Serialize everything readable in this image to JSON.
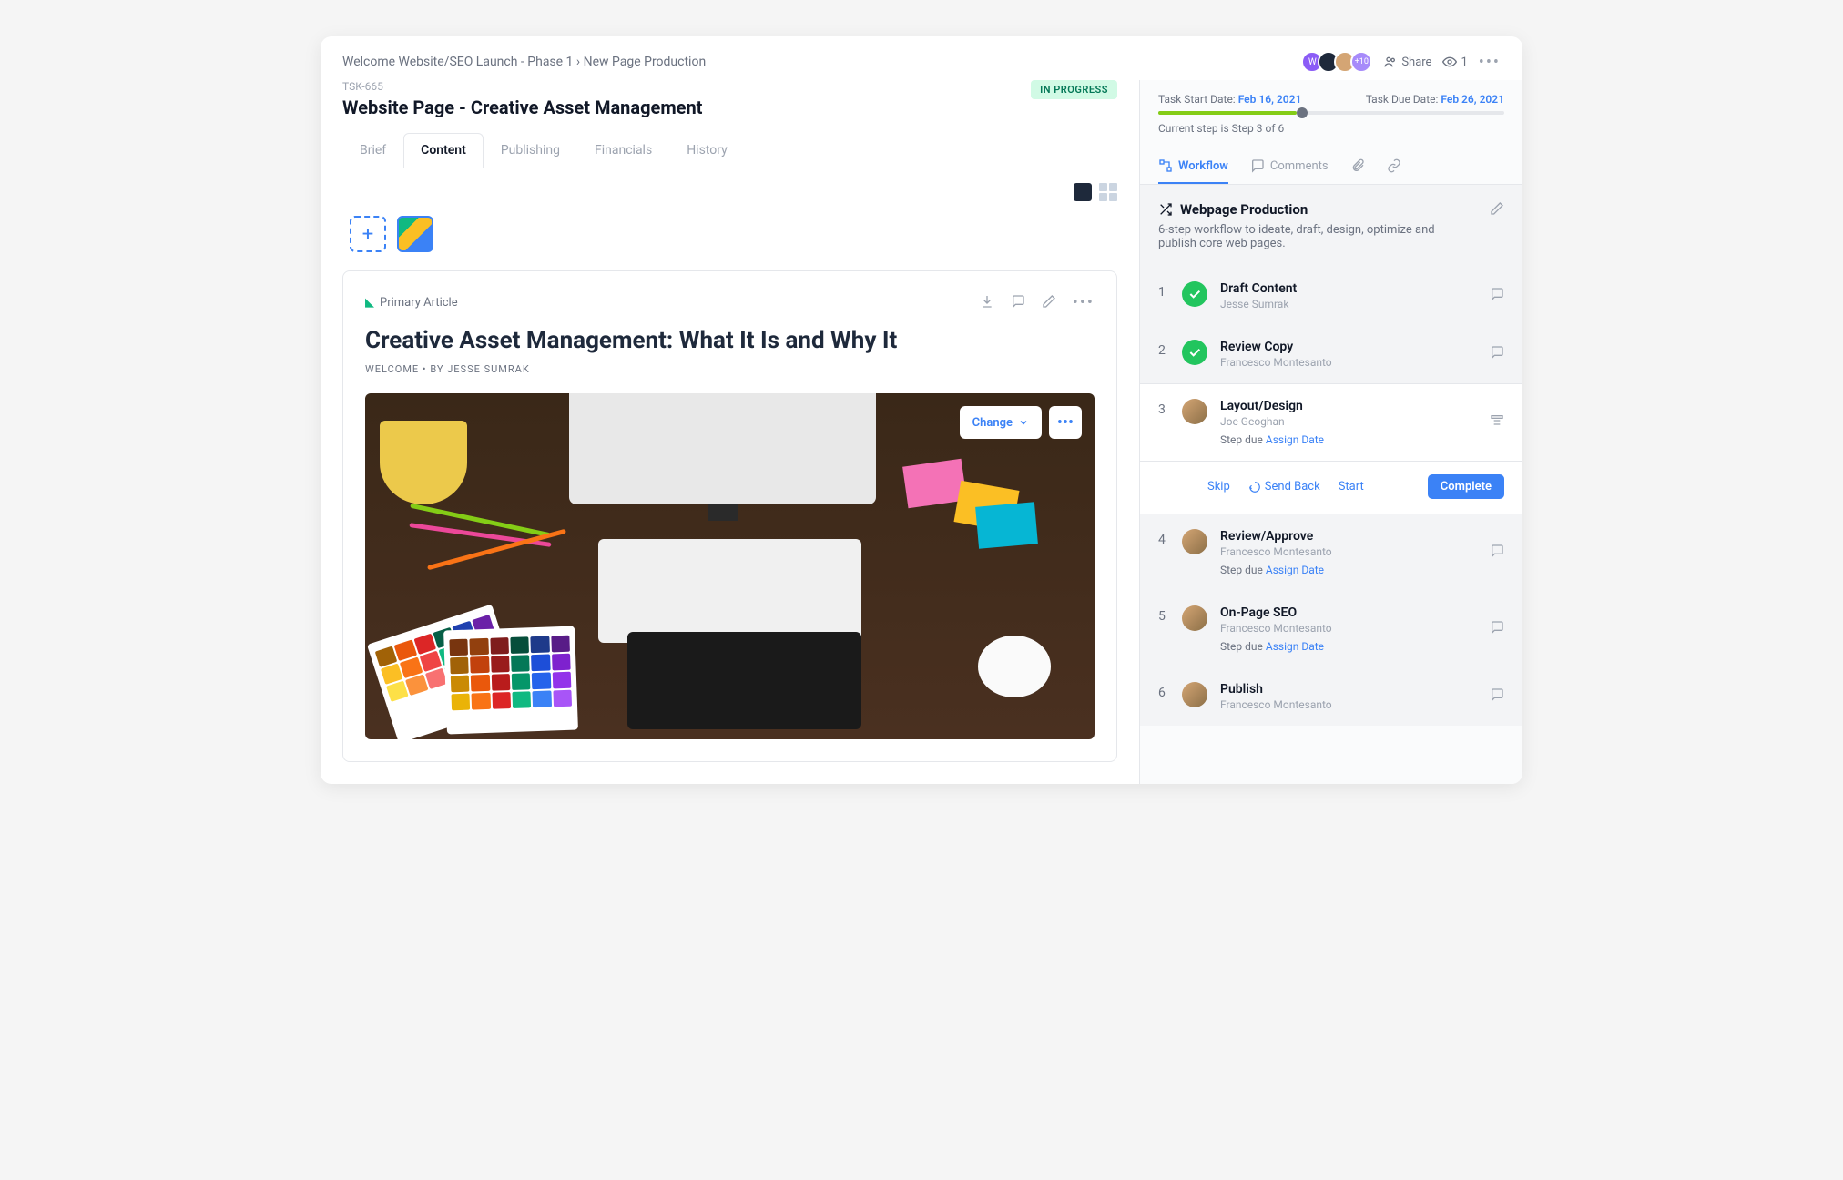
{
  "breadcrumb": {
    "a": "Welcome Website",
    "b": "SEO Launch - Phase 1",
    "c": "New Page Production"
  },
  "header": {
    "share": "Share",
    "watchers": "1",
    "avatarMore": "+10"
  },
  "task": {
    "id": "TSK-665",
    "title": "Website Page - Creative Asset Management",
    "status": "IN PROGRESS"
  },
  "tabs": {
    "brief": "Brief",
    "content": "Content",
    "publishing": "Publishing",
    "financials": "Financials",
    "history": "History"
  },
  "article": {
    "tag": "Primary Article",
    "title": "Creative Asset Management: What It Is and Why It",
    "meta": "WELCOME • BY JESSE SUMRAK",
    "change": "Change"
  },
  "dates": {
    "startLabel": "Task Start Date:",
    "startVal": "Feb 16, 2021",
    "dueLabel": "Task Due Date:",
    "dueVal": "Feb 26, 2021"
  },
  "progress": {
    "label": "Current step is Step 3 of 6"
  },
  "sideTabs": {
    "workflow": "Workflow",
    "comments": "Comments"
  },
  "workflow": {
    "title": "Webpage Production",
    "desc": "6-step workflow to ideate, draft, design, optimize and publish core web pages."
  },
  "steps": [
    {
      "n": "1",
      "title": "Draft Content",
      "who": "Jesse Sumrak",
      "done": true
    },
    {
      "n": "2",
      "title": "Review Copy",
      "who": "Francesco Montesanto",
      "done": true
    },
    {
      "n": "3",
      "title": "Layout/Design",
      "who": "Joe Geoghan",
      "dueLabel": "Step due",
      "dueLink": "Assign Date",
      "current": true
    },
    {
      "n": "4",
      "title": "Review/Approve",
      "who": "Francesco Montesanto",
      "dueLabel": "Step due",
      "dueLink": "Assign Date"
    },
    {
      "n": "5",
      "title": "On-Page SEO",
      "who": "Francesco Montesanto",
      "dueLabel": "Step due",
      "dueLink": "Assign Date"
    },
    {
      "n": "6",
      "title": "Publish",
      "who": "Francesco Montesanto"
    }
  ],
  "stepActions": {
    "skip": "Skip",
    "sendBack": "Send Back",
    "start": "Start",
    "complete": "Complete"
  }
}
